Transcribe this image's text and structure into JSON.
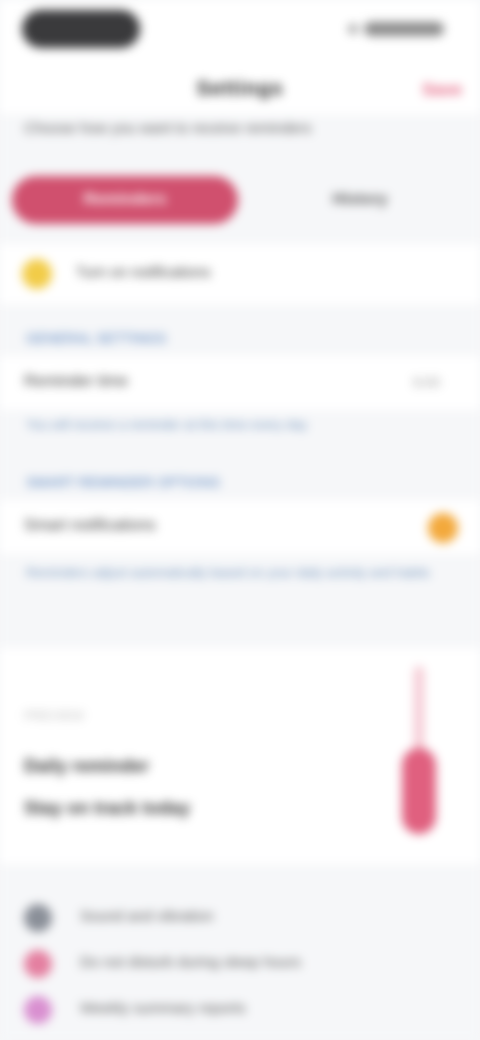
{
  "status_bar": {},
  "nav": {
    "title": "Settings",
    "action_label": "Save"
  },
  "subtitle": "Choose how you want to receive reminders",
  "tabs": [
    {
      "label": "Reminders",
      "active": true
    },
    {
      "label": "History",
      "active": false
    }
  ],
  "notice": {
    "icon": "info-icon",
    "text": "Turn on notifications"
  },
  "sections": {
    "general": {
      "label": "GENERAL SETTINGS",
      "row_label": "Reminder time",
      "row_value": "9:00",
      "helper": "You will receive a reminder at this time every day"
    },
    "smart": {
      "label": "SMART REMINDER OPTIONS",
      "row_label": "Smart notifications",
      "toggle_on": true,
      "toggle_color": "#f3a93c",
      "helper": "Reminders adjust automatically based on your daily activity and habits"
    }
  },
  "card": {
    "heading": "PREVIEW",
    "line1": "Daily reminder",
    "line2": "Stay on track today",
    "accent_color": "#e0607f"
  },
  "list": [
    {
      "icon": "bell-icon",
      "icon_color": "#8a8f98",
      "text": "Sound and vibration"
    },
    {
      "icon": "heart-icon",
      "icon_color": "#e47fa0",
      "text": "Do not disturb during sleep hours"
    },
    {
      "icon": "star-icon",
      "icon_color": "#d98fd0",
      "text": "Weekly summary reports"
    }
  ]
}
